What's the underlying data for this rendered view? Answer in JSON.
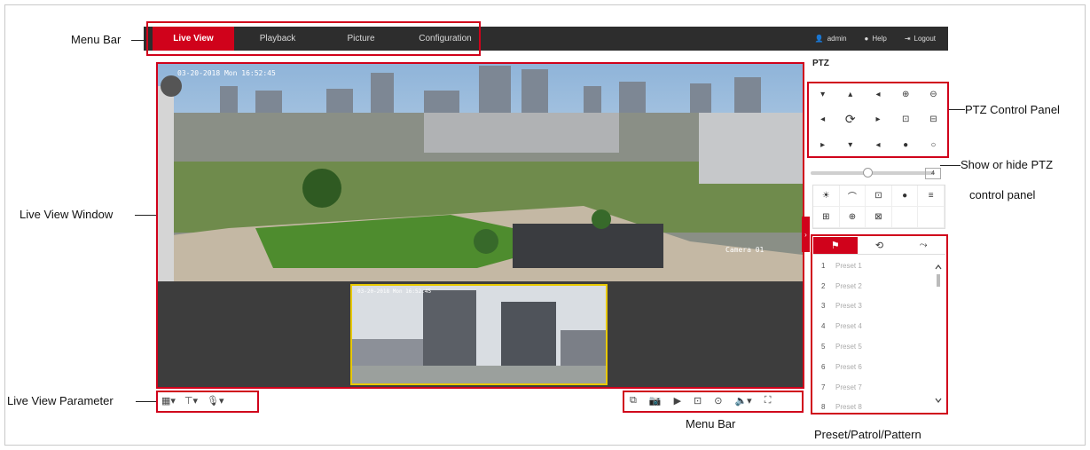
{
  "topbar": {
    "tabs": [
      {
        "label": "Live View",
        "active": true
      },
      {
        "label": "Playback",
        "active": false
      },
      {
        "label": "Picture",
        "active": false
      },
      {
        "label": "Configuration",
        "active": false
      }
    ],
    "user": "admin",
    "help": "Help",
    "logout": "Logout"
  },
  "live_view": {
    "osd_time": "03-20-2018 Mon 16:52:45",
    "osd_name": "Camera 01",
    "sub_osd_time": "03-20-2018 Mon 16:52:45"
  },
  "ptz": {
    "title": "PTZ",
    "speed": "4",
    "directions": [
      "▾",
      "▴",
      "◂",
      "◂",
      "⟳",
      "▸",
      "▸",
      "▾",
      "◂"
    ],
    "zoom_icons": [
      "⊕",
      "⊖",
      "⊡",
      "⊟",
      "●",
      "○"
    ]
  },
  "preset_tabs": [
    "⚑",
    "⟲",
    "⤳"
  ],
  "presets": [
    {
      "n": "1",
      "label": "Preset 1"
    },
    {
      "n": "2",
      "label": "Preset 2"
    },
    {
      "n": "3",
      "label": "Preset 3"
    },
    {
      "n": "4",
      "label": "Preset 4"
    },
    {
      "n": "5",
      "label": "Preset 5"
    },
    {
      "n": "6",
      "label": "Preset 6"
    },
    {
      "n": "7",
      "label": "Preset 7"
    },
    {
      "n": "8",
      "label": "Preset 8"
    }
  ],
  "annotations": {
    "menu_bar_top": "Menu Bar",
    "live_view_window": "Live View Window",
    "live_view_parameter": "Live View Parameter",
    "menu_bar_bottom": "Menu Bar",
    "ptz_control_panel": "PTZ Control Panel",
    "show_hide_ptz": "Show or hide PTZ",
    "control_panel": "control panel",
    "preset_patrol_pattern": "Preset/Patrol/Pattern"
  }
}
